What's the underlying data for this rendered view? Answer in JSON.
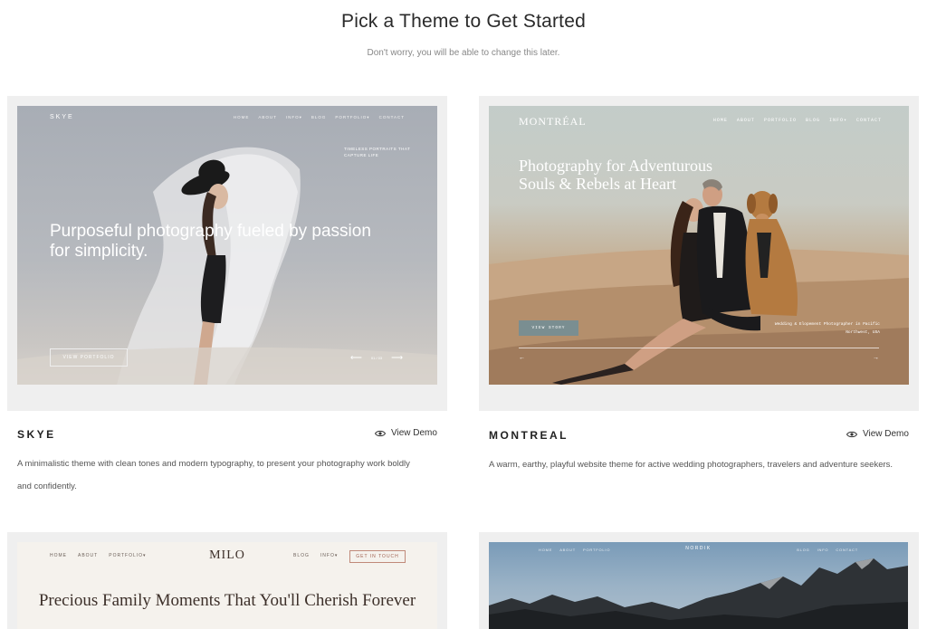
{
  "page": {
    "title": "Pick a Theme to Get Started",
    "subtitle": "Don't worry, you will be able to change this later."
  },
  "themes": [
    {
      "name": "SKYE",
      "view_demo": "View Demo",
      "description": "A minimalistic theme with clean tones and modern typography, to present your photography work boldly and confidently.",
      "preview": {
        "logo": "SKYE",
        "nav": [
          "HOME",
          "ABOUT",
          "INFO▾",
          "BLOG",
          "PORTFOLIO▾",
          "CONTACT"
        ],
        "tagline": "TIMELESS PORTRAITS THAT CAPTURE LIFE",
        "hero": "Purposeful photography fueled by passion for simplicity.",
        "button": "VIEW PORTFOLIO",
        "pager": "01 / 03"
      }
    },
    {
      "name": "MONTREAL",
      "view_demo": "View Demo",
      "description": "A warm, earthy, playful website theme for active wedding photographers, travelers and adventure seekers.",
      "preview": {
        "logo": "MONTRÉAL",
        "nav": [
          "HOME",
          "ABOUT",
          "PORTFOLIO",
          "BLOG",
          "INFO▾",
          "CONTACT"
        ],
        "hero": "Photography for Adventurous Souls & Rebels at Heart",
        "button": "VIEW STORY",
        "sub": "Wedding & Elopement Photographer in Pacific Northwest, USA"
      }
    },
    {
      "name": "MILO",
      "preview": {
        "logo": "MILO",
        "nav_left": [
          "HOME",
          "ABOUT",
          "PORTFOLIO▾"
        ],
        "nav_right": [
          "BLOG",
          "INFO▾"
        ],
        "button": "GET IN TOUCH",
        "hero": "Precious Family Moments That You'll Cherish Forever"
      }
    },
    {
      "name": "NORDIK",
      "preview": {
        "logo": "NORDIK",
        "nav_left": [
          "HOME",
          "ABOUT",
          "PORTFOLIO"
        ],
        "nav_right": [
          "BLOG",
          "INFO",
          "CONTACT"
        ]
      }
    }
  ]
}
